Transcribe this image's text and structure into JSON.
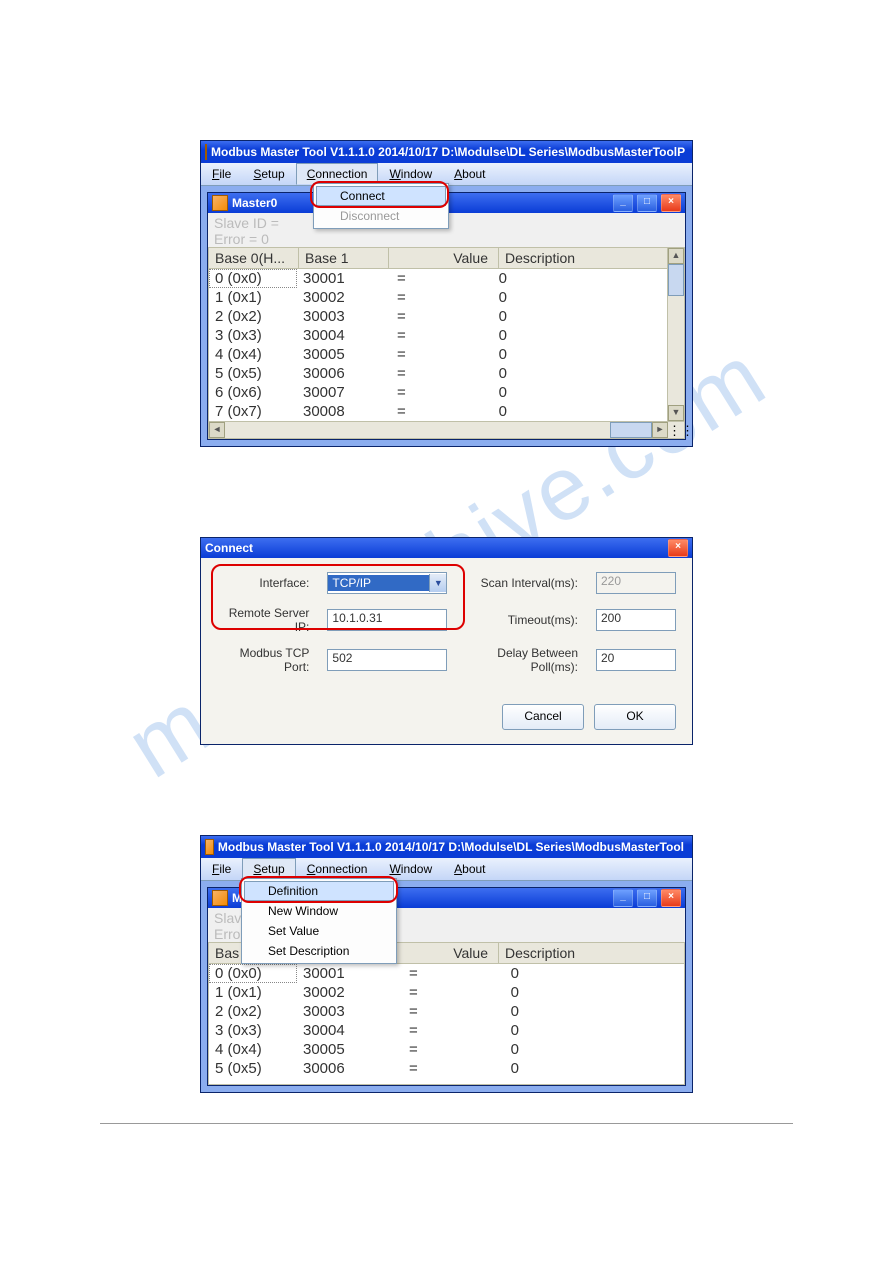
{
  "watermark": "manualshive.com",
  "win1": {
    "title": "Modbus Master Tool V1.1.1.0  2014/10/17  D:\\Modulse\\DL Series\\ModbusMasterToolP",
    "menu": {
      "file": "File",
      "setup": "Setup",
      "connection": "Connection",
      "window": "Window",
      "about": "About"
    },
    "conn_menu": {
      "connect": "Connect",
      "disconnect": "Disconnect"
    },
    "child_title": "Master0",
    "slave_line": "Slave ID =",
    "error_line": "Error = 0",
    "headers": {
      "base0": "Base 0(H...",
      "base1": "Base 1",
      "value": "Value",
      "desc": "Description"
    },
    "rows": [
      {
        "b0": "0 (0x0)",
        "b1": "30001",
        "eq": "=",
        "v": "0"
      },
      {
        "b0": "1 (0x1)",
        "b1": "30002",
        "eq": "=",
        "v": "0"
      },
      {
        "b0": "2 (0x2)",
        "b1": "30003",
        "eq": "=",
        "v": "0"
      },
      {
        "b0": "3 (0x3)",
        "b1": "30004",
        "eq": "=",
        "v": "0"
      },
      {
        "b0": "4 (0x4)",
        "b1": "30005",
        "eq": "=",
        "v": "0"
      },
      {
        "b0": "5 (0x5)",
        "b1": "30006",
        "eq": "=",
        "v": "0"
      },
      {
        "b0": "6 (0x6)",
        "b1": "30007",
        "eq": "=",
        "v": "0"
      },
      {
        "b0": "7 (0x7)",
        "b1": "30008",
        "eq": "=",
        "v": "0"
      }
    ]
  },
  "dlg": {
    "title": "Connect",
    "interface_label": "Interface:",
    "interface_value": "TCP/IP",
    "ip_label": "Remote Server IP:",
    "ip_value": "10.1.0.31",
    "port_label": "Modbus TCP Port:",
    "port_value": "502",
    "scan_label": "Scan Interval(ms):",
    "scan_value": "220",
    "timeout_label": "Timeout(ms):",
    "timeout_value": "200",
    "delay_label": "Delay Between Poll(ms):",
    "delay_value": "20",
    "cancel": "Cancel",
    "ok": "OK"
  },
  "win2": {
    "title": "Modbus Master Tool V1.1.1.0  2014/10/17  D:\\Modulse\\DL Series\\ModbusMasterTool",
    "menu": {
      "file": "File",
      "setup": "Setup",
      "connection": "Connection",
      "window": "Window",
      "about": "About"
    },
    "setup_menu": {
      "definition": "Definition",
      "new_window": "New Window",
      "set_value": "Set Value",
      "set_description": "Set Description"
    },
    "child_title_partial": "M",
    "slave_partial": "Slave",
    "error_partial": "Erro",
    "headers": {
      "base0": "Bas",
      "value": "Value",
      "desc": "Description"
    },
    "rows": [
      {
        "b0": "0 (0x0)",
        "b1": "30001",
        "eq": "=",
        "v": "0"
      },
      {
        "b0": "1 (0x1)",
        "b1": "30002",
        "eq": "=",
        "v": "0"
      },
      {
        "b0": "2 (0x2)",
        "b1": "30003",
        "eq": "=",
        "v": "0"
      },
      {
        "b0": "3 (0x3)",
        "b1": "30004",
        "eq": "=",
        "v": "0"
      },
      {
        "b0": "4 (0x4)",
        "b1": "30005",
        "eq": "=",
        "v": "0"
      },
      {
        "b0": "5 (0x5)",
        "b1": "30006",
        "eq": "=",
        "v": "0"
      }
    ]
  }
}
